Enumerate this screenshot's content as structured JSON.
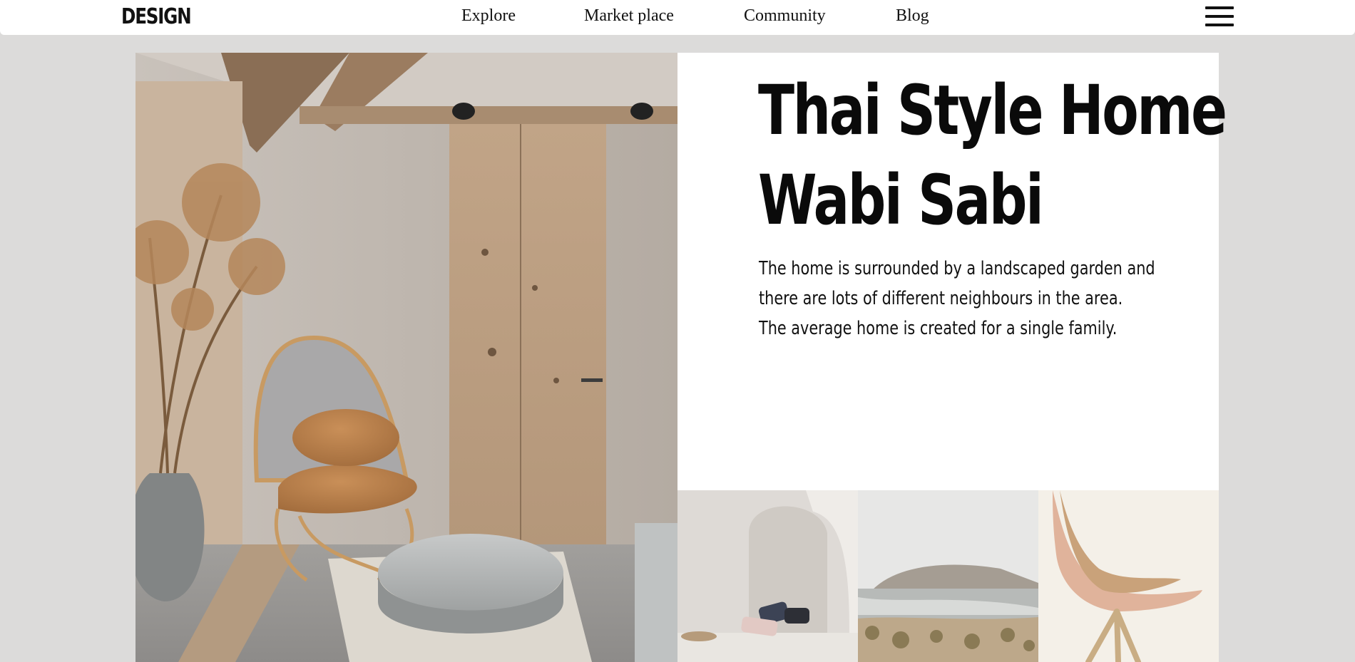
{
  "nav": {
    "logo": "DESIGN",
    "links": [
      "Explore",
      "Market place",
      "Community",
      "Blog"
    ]
  },
  "hero": {
    "title_line1": "Thai Style Home",
    "title_line2": "Wabi Sabi",
    "desc_line1": "The home is surrounded by a landscaped garden and",
    "desc_line2": "there are lots of different neighbours in the area.",
    "desc_line3": "The average home is created for a single family."
  },
  "colors": {
    "background": "#dcdbda",
    "panel": "#ffffff",
    "text": "#0a0a0a"
  },
  "icons": {
    "menu": "hamburger-menu-icon"
  }
}
